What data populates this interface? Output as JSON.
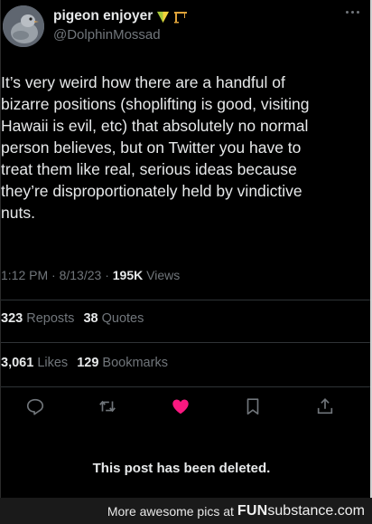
{
  "profile": {
    "display_name": "pigeon enjoyer",
    "handle": "@DolphinMossad",
    "badges": [
      "leaf-badge-icon",
      "crane-icon"
    ]
  },
  "tweet": {
    "text": "It’s very weird how there are a handful of\nbizarre positions (shoplifting is good, visiting\nHawaii is evil, etc) that absolutely no normal\nperson believes, but on Twitter you have to\ntreat them like real, serious ideas because\nthey’re disproportionately held by vindictive\nnuts."
  },
  "meta": {
    "time": "1:12 PM",
    "sep1": " · ",
    "date": "8/13/23",
    "sep2": " · ",
    "views_count": "195K",
    "views_label": " Views"
  },
  "stats": {
    "reposts_count": "323",
    "reposts_label": " Reposts",
    "quotes_count": "38",
    "quotes_label": " Quotes",
    "likes_count": "3,061",
    "likes_label": " Likes",
    "bookmarks_count": "129",
    "bookmarks_label": " Bookmarks"
  },
  "actions": [
    "reply-icon",
    "repost-icon",
    "like-icon",
    "bookmark-icon",
    "share-icon"
  ],
  "colors": {
    "like": "#f91880",
    "muted": "#71767b",
    "text": "#e7e9ea"
  },
  "notice": "This post has been deleted.",
  "footer": {
    "text": "More awesome pics at",
    "brand_a": "FUN",
    "brand_b": "substance.com"
  }
}
